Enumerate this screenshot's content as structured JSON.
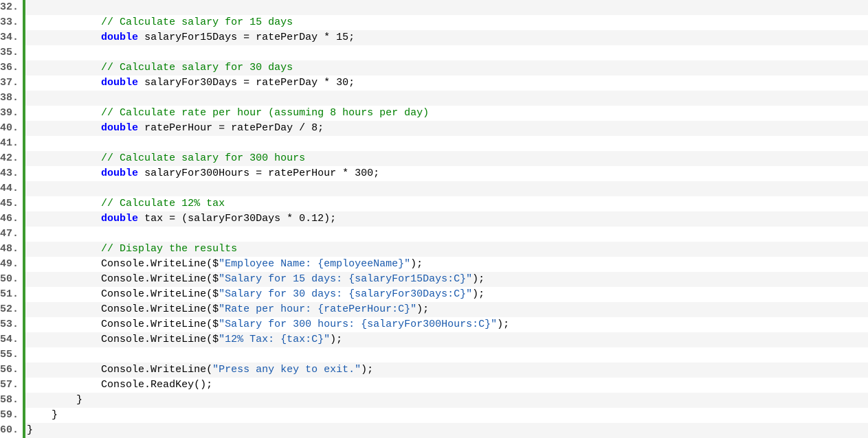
{
  "startLine": 32,
  "lines": [
    {
      "indent": 12,
      "tokens": []
    },
    {
      "indent": 12,
      "tokens": [
        {
          "t": "comment",
          "v": "// Calculate salary for 15 days"
        }
      ]
    },
    {
      "indent": 12,
      "tokens": [
        {
          "t": "keyword",
          "v": "double"
        },
        {
          "t": "plain",
          "v": " salaryFor15Days = ratePerDay * 15;"
        }
      ]
    },
    {
      "indent": 12,
      "tokens": []
    },
    {
      "indent": 12,
      "tokens": [
        {
          "t": "comment",
          "v": "// Calculate salary for 30 days"
        }
      ]
    },
    {
      "indent": 12,
      "tokens": [
        {
          "t": "keyword",
          "v": "double"
        },
        {
          "t": "plain",
          "v": " salaryFor30Days = ratePerDay * 30;"
        }
      ]
    },
    {
      "indent": 12,
      "tokens": []
    },
    {
      "indent": 12,
      "tokens": [
        {
          "t": "comment",
          "v": "// Calculate rate per hour (assuming 8 hours per day)"
        }
      ]
    },
    {
      "indent": 12,
      "tokens": [
        {
          "t": "keyword",
          "v": "double"
        },
        {
          "t": "plain",
          "v": " ratePerHour = ratePerDay / 8;"
        }
      ]
    },
    {
      "indent": 12,
      "tokens": []
    },
    {
      "indent": 12,
      "tokens": [
        {
          "t": "comment",
          "v": "// Calculate salary for 300 hours"
        }
      ]
    },
    {
      "indent": 12,
      "tokens": [
        {
          "t": "keyword",
          "v": "double"
        },
        {
          "t": "plain",
          "v": " salaryFor300Hours = ratePerHour * 300;"
        }
      ]
    },
    {
      "indent": 12,
      "tokens": []
    },
    {
      "indent": 12,
      "tokens": [
        {
          "t": "comment",
          "v": "// Calculate 12% tax"
        }
      ]
    },
    {
      "indent": 12,
      "tokens": [
        {
          "t": "keyword",
          "v": "double"
        },
        {
          "t": "plain",
          "v": " tax = (salaryFor30Days * 0.12);"
        }
      ]
    },
    {
      "indent": 12,
      "tokens": []
    },
    {
      "indent": 12,
      "tokens": [
        {
          "t": "comment",
          "v": "// Display the results"
        }
      ]
    },
    {
      "indent": 12,
      "tokens": [
        {
          "t": "plain",
          "v": "Console.WriteLine($"
        },
        {
          "t": "string",
          "v": "\"Employee Name: {employeeName}\""
        },
        {
          "t": "plain",
          "v": ");"
        }
      ]
    },
    {
      "indent": 12,
      "tokens": [
        {
          "t": "plain",
          "v": "Console.WriteLine($"
        },
        {
          "t": "string",
          "v": "\"Salary for 15 days: {salaryFor15Days:C}\""
        },
        {
          "t": "plain",
          "v": ");"
        }
      ]
    },
    {
      "indent": 12,
      "tokens": [
        {
          "t": "plain",
          "v": "Console.WriteLine($"
        },
        {
          "t": "string",
          "v": "\"Salary for 30 days: {salaryFor30Days:C}\""
        },
        {
          "t": "plain",
          "v": ");"
        }
      ]
    },
    {
      "indent": 12,
      "tokens": [
        {
          "t": "plain",
          "v": "Console.WriteLine($"
        },
        {
          "t": "string",
          "v": "\"Rate per hour: {ratePerHour:C}\""
        },
        {
          "t": "plain",
          "v": ");"
        }
      ]
    },
    {
      "indent": 12,
      "tokens": [
        {
          "t": "plain",
          "v": "Console.WriteLine($"
        },
        {
          "t": "string",
          "v": "\"Salary for 300 hours: {salaryFor300Hours:C}\""
        },
        {
          "t": "plain",
          "v": ");"
        }
      ]
    },
    {
      "indent": 12,
      "tokens": [
        {
          "t": "plain",
          "v": "Console.WriteLine($"
        },
        {
          "t": "string",
          "v": "\"12% Tax: {tax:C}\""
        },
        {
          "t": "plain",
          "v": ");"
        }
      ]
    },
    {
      "indent": 12,
      "tokens": []
    },
    {
      "indent": 12,
      "tokens": [
        {
          "t": "plain",
          "v": "Console.WriteLine("
        },
        {
          "t": "string",
          "v": "\"Press any key to exit.\""
        },
        {
          "t": "plain",
          "v": ");"
        }
      ]
    },
    {
      "indent": 12,
      "tokens": [
        {
          "t": "plain",
          "v": "Console.ReadKey();"
        }
      ]
    },
    {
      "indent": 8,
      "tokens": [
        {
          "t": "plain",
          "v": "}"
        }
      ]
    },
    {
      "indent": 4,
      "tokens": [
        {
          "t": "plain",
          "v": "}"
        }
      ]
    },
    {
      "indent": 0,
      "tokens": [
        {
          "t": "plain",
          "v": "}"
        }
      ]
    }
  ]
}
